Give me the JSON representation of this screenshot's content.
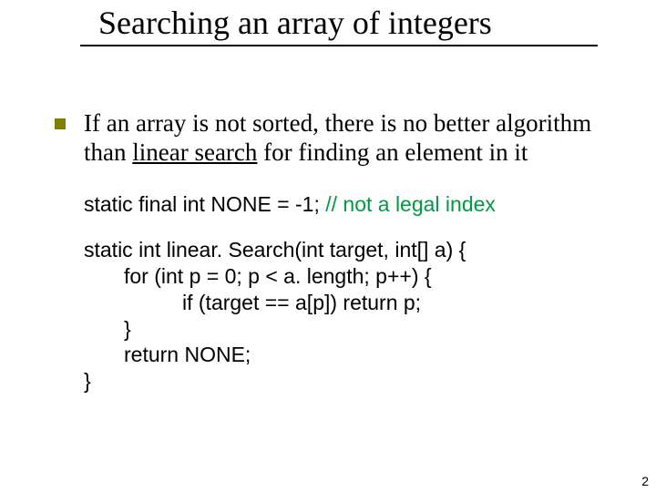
{
  "title": "Searching an array of integers",
  "bullet": {
    "pre": "If an array is not sorted, there is no better algorithm than ",
    "ul": "linear search",
    "post": " for finding an element in it"
  },
  "code": {
    "const_line": "static final int NONE = -1;  ",
    "comment": "// not a legal index",
    "l1": "static int linear. Search(int target, int[] a) {",
    "l2": "for (int p = 0; p < a. length; p++) {",
    "l3": "if (target == a[p]) return p;",
    "l4": "}",
    "l5": "return NONE;",
    "l6": "}"
  },
  "page": "2"
}
